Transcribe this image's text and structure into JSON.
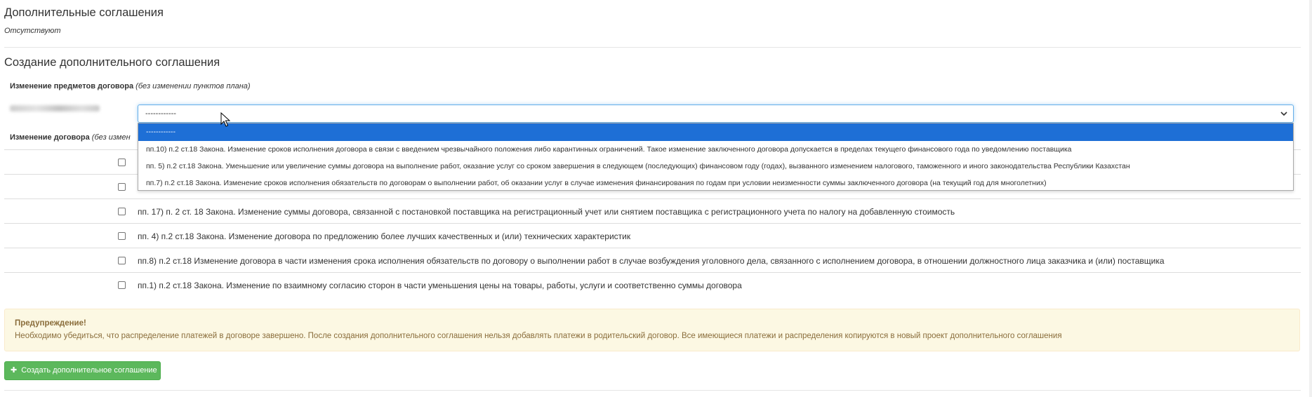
{
  "supplementary": {
    "title": "Дополнительные соглашения",
    "status": "Отсутствуют"
  },
  "create": {
    "title": "Создание дополнительного соглашения",
    "subjects_label": "Изменение предметов договора",
    "subjects_note": "(без изменении пунктов плана)",
    "contract_label": "Изменение договора",
    "contract_note": "(без измен"
  },
  "select": {
    "value": "------------",
    "options": [
      "------------",
      "пп.10) п.2 ст.18 Закона. Изменение сроков исполнения договора в связи с введением чрезвычайного положения либо карантинных ограничений. Такое изменение заключенного договора допускается в пределах текущего финансового года по уведомлению поставщика",
      "пп. 5) п.2 ст.18 Закона. Уменьшение или увеличение суммы договора на выполнение работ, оказание услуг со сроком завершения в следующем (последующих) финансовом году (годах), вызванного изменением налогового, таможенного и иного законодательства Республики Казахстан",
      "пп.7) п.2 ст.18 Закона. Изменение сроков исполнения обязательств по договорам о выполнении работ, об оказании услуг в случае изменения финансирования по годам при условии неизменности суммы заключенного договора (на текущий год для многолетних)"
    ]
  },
  "rows": [
    "",
    "",
    "пп. 17) п. 2 ст. 18 Закона. Изменение суммы договора, связанной с постановкой поставщика на регистрационный учет или снятием поставщика с регистрационного учета по налогу на добавленную стоимость",
    "пп. 4) п.2 ст.18 Закона. Изменение договора по предложению более лучших качественных и (или) технических характеристик",
    "пп.8) п.2 ст.18 Изменение договора в части изменения срока исполнения обязательств по договору о выполнении работ в случае возбуждения уголовного дела, связанного с исполнением договора, в отношении должностного лица заказчика и (или) поставщика",
    "пп.1) п.2 ст.18 Закона. Изменение по взаимному согласию сторон в части уменьшения цены на товары, работы, услуги и соответственно суммы договора"
  ],
  "alert": {
    "title": "Предупреждение!",
    "body": "Необходимо убедиться, что распределение платежей в договоре завершено. После создания дополнительного соглашения нельзя добавлять платежи в родительский договор. Все имеющиеся платежи и распределения копируются в новый проект дополнительного соглашения"
  },
  "button": {
    "icon": "plus-icon",
    "label": "Создать дополнительное соглашение"
  },
  "colors": {
    "alert_bg": "#fcf8e3",
    "alert_text": "#8a6d3b",
    "button_bg": "#5cb85c",
    "selected_option": "#1e6fd6",
    "focus_border": "#66afe9"
  }
}
